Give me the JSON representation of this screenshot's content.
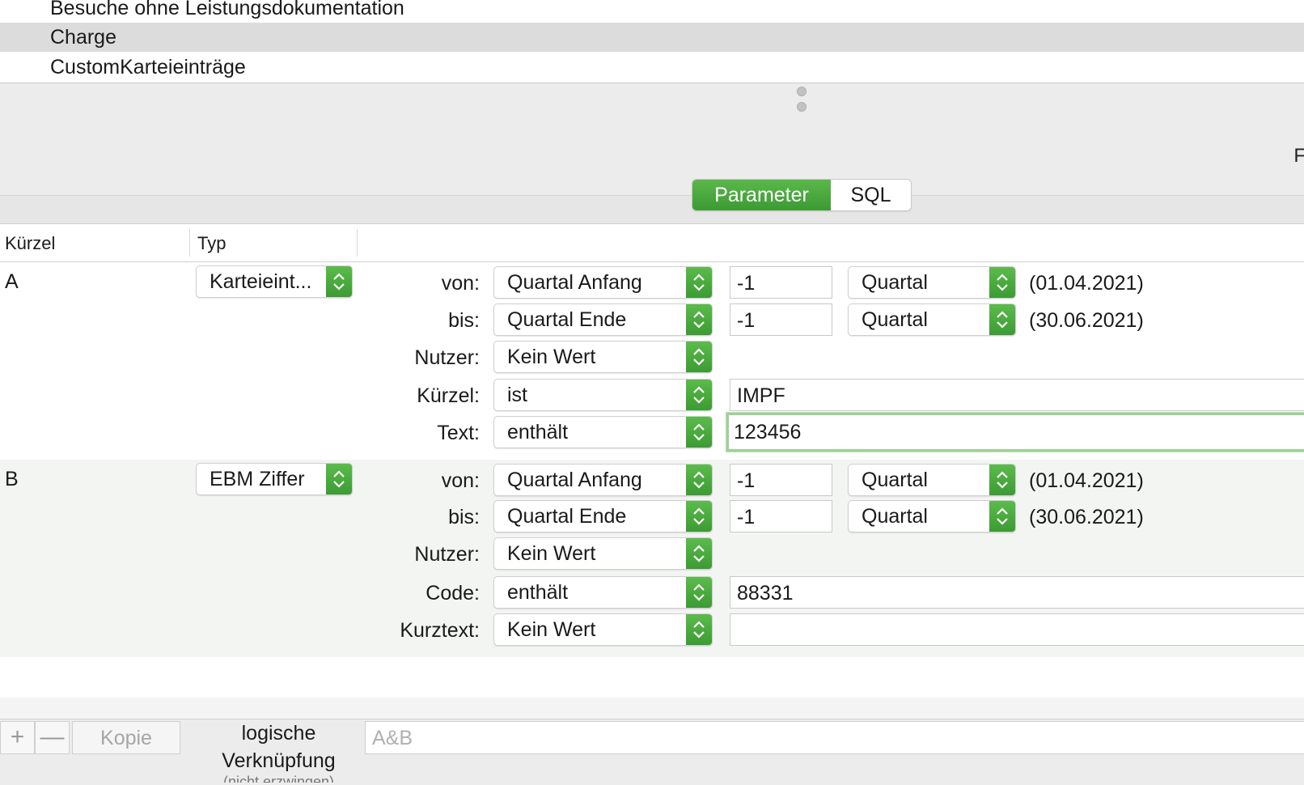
{
  "query_list": {
    "items": [
      {
        "label": "Besuche ohne Leistungsdokumentation",
        "selected": false
      },
      {
        "label": "Charge",
        "selected": true
      },
      {
        "label": "CustomKarteieinträge",
        "selected": false
      }
    ]
  },
  "edge_glyph": "F",
  "mode_toggle": {
    "options": [
      "Parameter",
      "SQL"
    ],
    "active": "Parameter"
  },
  "table": {
    "headers": {
      "kuerzel": "Kürzel",
      "typ": "Typ"
    },
    "rows": [
      {
        "letter": "A",
        "type": "Karteieint...",
        "von": {
          "label": "von:",
          "anchor": "Quartal Anfang",
          "offset": "-1",
          "unit": "Quartal",
          "date": "(01.04.2021)"
        },
        "bis": {
          "label": "bis:",
          "anchor": "Quartal Ende",
          "offset": "-1",
          "unit": "Quartal",
          "date": "(30.06.2021)"
        },
        "nutzer": {
          "label": "Nutzer:",
          "value": "Kein Wert"
        },
        "f1": {
          "label": "Kürzel:",
          "op": "ist",
          "value": "IMPF"
        },
        "f2": {
          "label": "Text:",
          "op": "enthält",
          "value": "123456"
        }
      },
      {
        "letter": "B",
        "type": "EBM Ziffer",
        "von": {
          "label": "von:",
          "anchor": "Quartal Anfang",
          "offset": "-1",
          "unit": "Quartal",
          "date": "(01.04.2021)"
        },
        "bis": {
          "label": "bis:",
          "anchor": "Quartal Ende",
          "offset": "-1",
          "unit": "Quartal",
          "date": "(30.06.2021)"
        },
        "nutzer": {
          "label": "Nutzer:",
          "value": "Kein Wert"
        },
        "f1": {
          "label": "Code:",
          "op": "enthält",
          "value": "88331"
        },
        "f2": {
          "label": "Kurztext:",
          "op": "Kein Wert",
          "value": ""
        }
      }
    ]
  },
  "bottom": {
    "add_label": "+",
    "remove_label": "—",
    "copy_label": "Kopie",
    "logic_label_line1": "logische",
    "logic_label_line2": "Verknüpfung",
    "logic_label_line3": "(nicht erzwingen)",
    "logic_value": "A&B"
  },
  "colors": {
    "accent_green": "#4caf3f",
    "selection_gray": "#dcdcdc",
    "focus_ring": "#9ed196"
  }
}
